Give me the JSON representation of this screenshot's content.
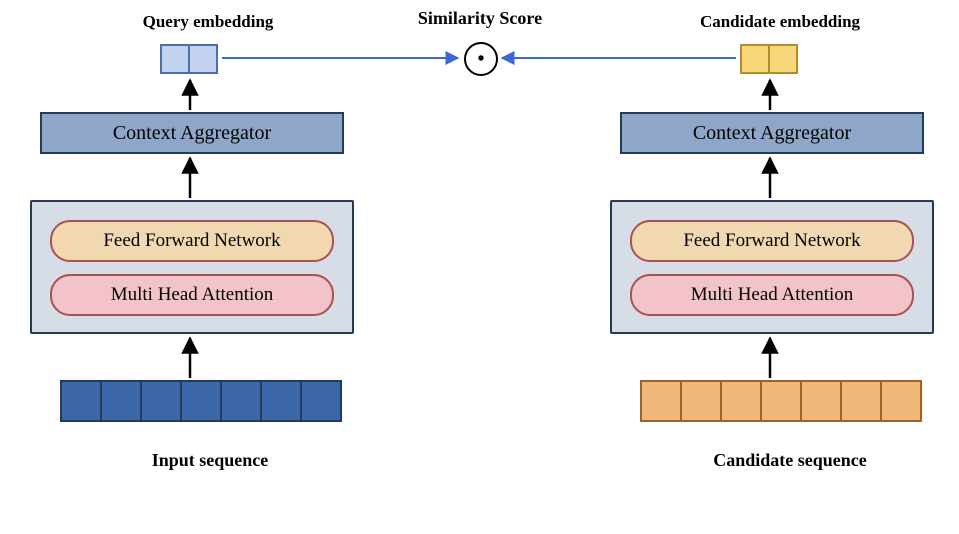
{
  "top": {
    "score_label": "Similarity Score",
    "query_emb_label": "Query embedding",
    "cand_emb_label": "Candidate embedding"
  },
  "left": {
    "aggregator": "Context Aggregator",
    "ffn": "Feed Forward Network",
    "mha": "Multi Head Attention",
    "caption": "Input sequence",
    "seq_cells": 7,
    "emb_cells": 2
  },
  "right": {
    "aggregator": "Context Aggregator",
    "ffn": "Feed Forward Network",
    "mha": "Multi Head Attention",
    "caption": "Candidate sequence",
    "seq_cells": 7,
    "emb_cells": 2
  },
  "colors": {
    "query_emb_fill": "#c3d3ef",
    "query_emb_border": "#4b6fa8",
    "cand_emb_fill": "#f6d77a",
    "cand_emb_border": "#b58c2a",
    "arrow_blue": "#3b66d6",
    "arrow_black": "#000000"
  }
}
